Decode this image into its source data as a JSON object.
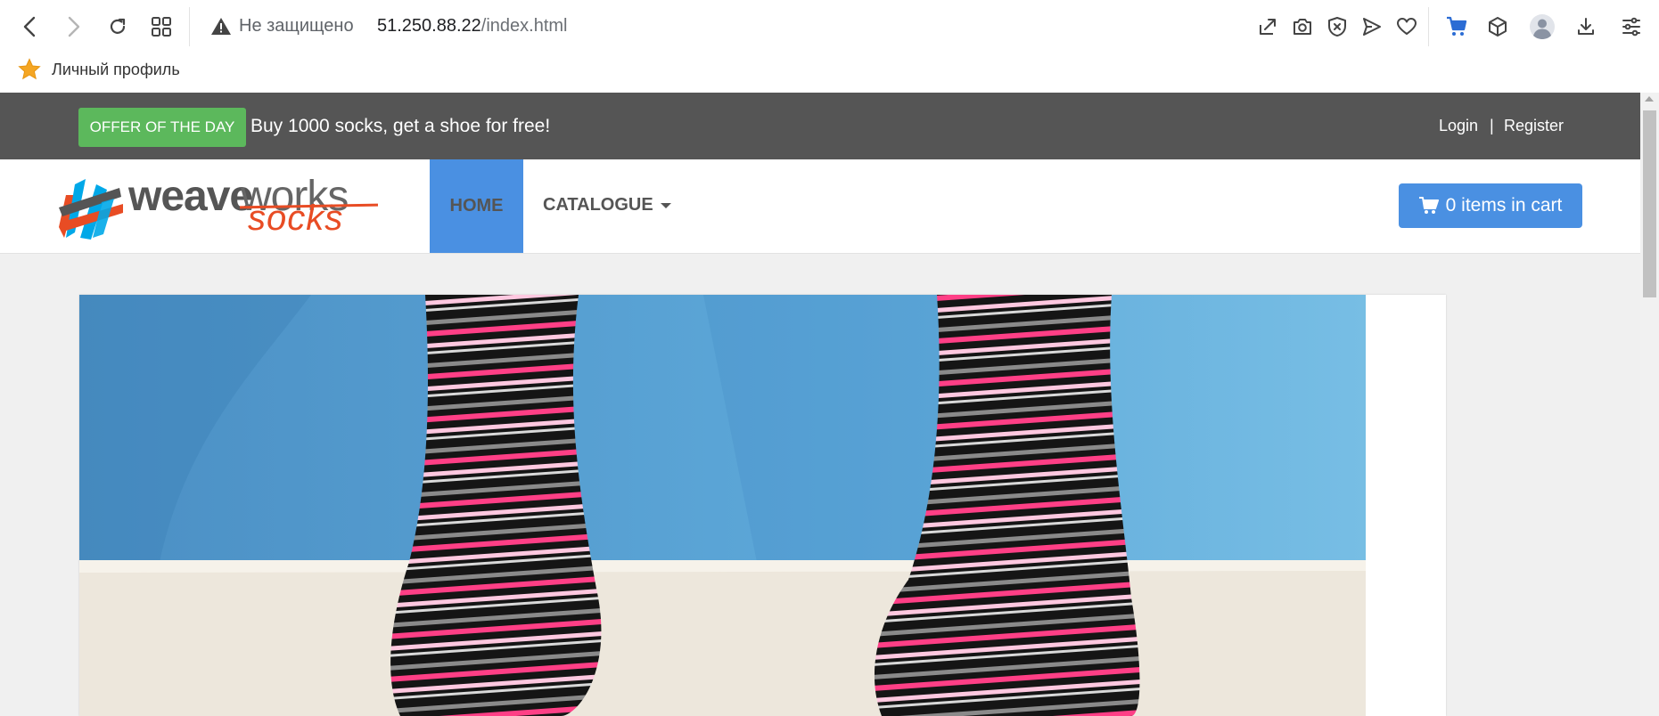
{
  "browser": {
    "address": {
      "security_label": "Не защищено",
      "host": "51.250.88.22",
      "path": "/index.html"
    },
    "bookmarks": [
      {
        "label": "Личный профиль",
        "icon": "star-icon"
      }
    ]
  },
  "site": {
    "offer": {
      "badge": "OFFER OF THE DAY",
      "text": "Buy 1000 socks, get a shoe for free!"
    },
    "auth": {
      "login": "Login",
      "separator": "|",
      "register": "Register"
    },
    "logo": {
      "weave": "weave",
      "works": "works",
      "socks": "socks"
    },
    "nav": {
      "home": "HOME",
      "catalogue": "CATALOGUE"
    },
    "cart": {
      "label": "0 items in cart"
    }
  },
  "colors": {
    "topbar": "#555555",
    "offer_badge": "#5cb85c",
    "accent": "#4a90e2",
    "logo_accent": "#e84c24"
  }
}
